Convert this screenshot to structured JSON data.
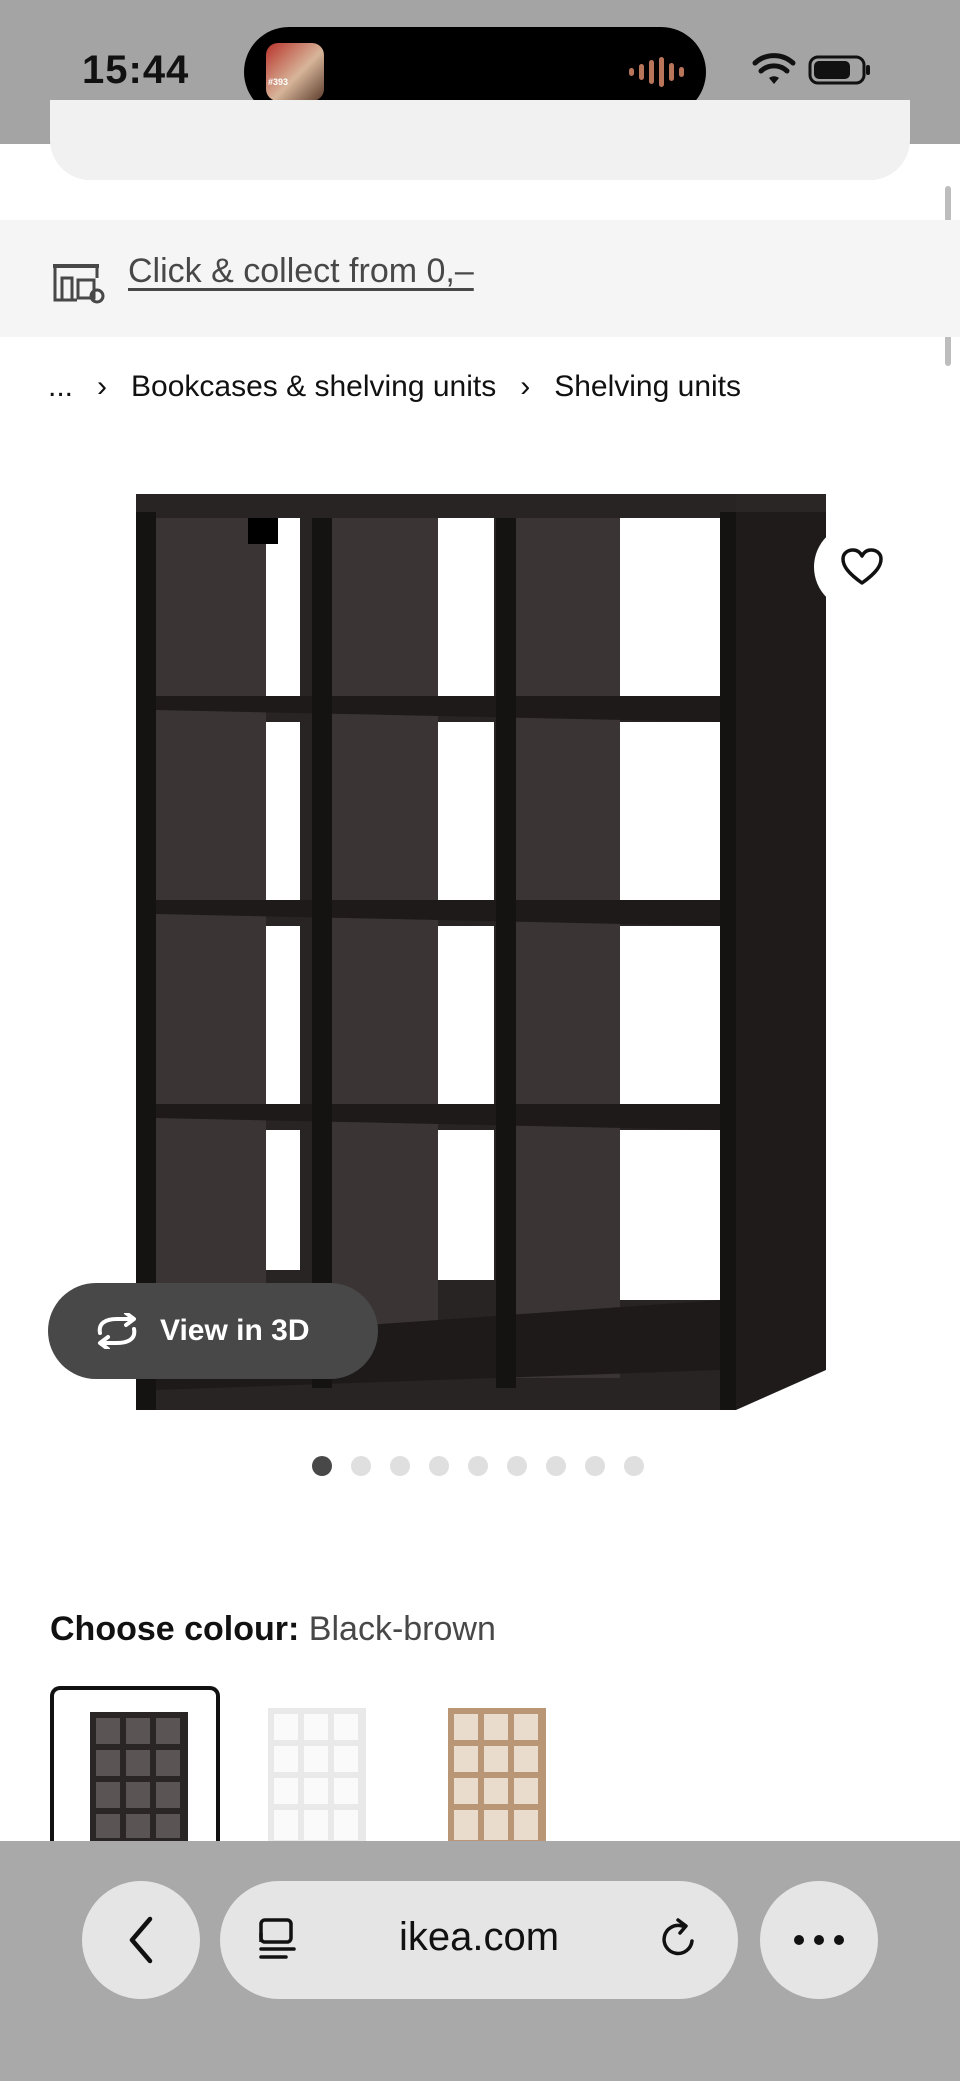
{
  "status": {
    "time": "15:44",
    "island_thumb_text": "#393"
  },
  "collect": {
    "link": "Click & collect from 0,–"
  },
  "breadcrumb": {
    "ellipsis": "...",
    "items": [
      "Bookcases & shelving units",
      "Shelving units"
    ],
    "separator": "›"
  },
  "product": {
    "view3d_label": "View in 3D",
    "image_icon": "shelving-unit-image",
    "dots_total": 9,
    "dots_active": 1
  },
  "colour": {
    "heading": "Choose colour:",
    "value": "Black-brown",
    "options": [
      "Black-brown",
      "White",
      "White stained oak effect"
    ]
  },
  "browser": {
    "url": "ikea.com"
  },
  "colors": {
    "accent": "#484848",
    "status_bar": "#a4a4a4",
    "shelf": "#2a2626"
  }
}
